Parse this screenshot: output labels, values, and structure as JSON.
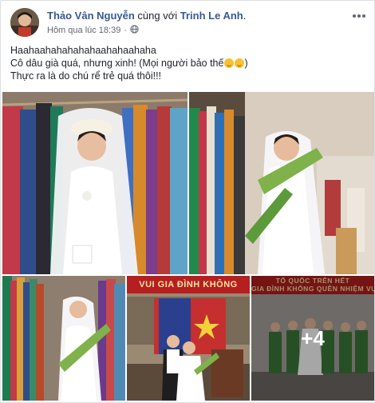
{
  "post": {
    "author": "Thảo Vân Nguyễn",
    "with_text": "cùng với",
    "tagged": "Trinh Le Anh",
    "tagged_suffix": ".",
    "timestamp": "Hôm qua lúc 18:39",
    "separator": "·",
    "lines": [
      "Haahaahahahahahaahahaahaha",
      "Cô dâu già quá, nhưng xinh! (Mọi người bảo thế",
      ")",
      "Thực ra là do chú rể trẻ quá thôi!!!"
    ]
  },
  "photos": {
    "banner_center": "VUI GIA ĐÌNH KHÔNG",
    "banner_right_top": "TỔ QUỐC TRÊN HẾT",
    "banner_right_bottom": "GIA ĐÌNH KHÔNG QUÊN NHIỆM VỤ",
    "more_count": "+4"
  },
  "icons": {
    "privacy": "globe-icon",
    "menu": "more-options-icon",
    "reaction": "smiley-emoji-icon"
  },
  "colors": {
    "link": "#385898",
    "text": "#1d2129",
    "meta": "#616770",
    "banner": "#b61f1f"
  }
}
